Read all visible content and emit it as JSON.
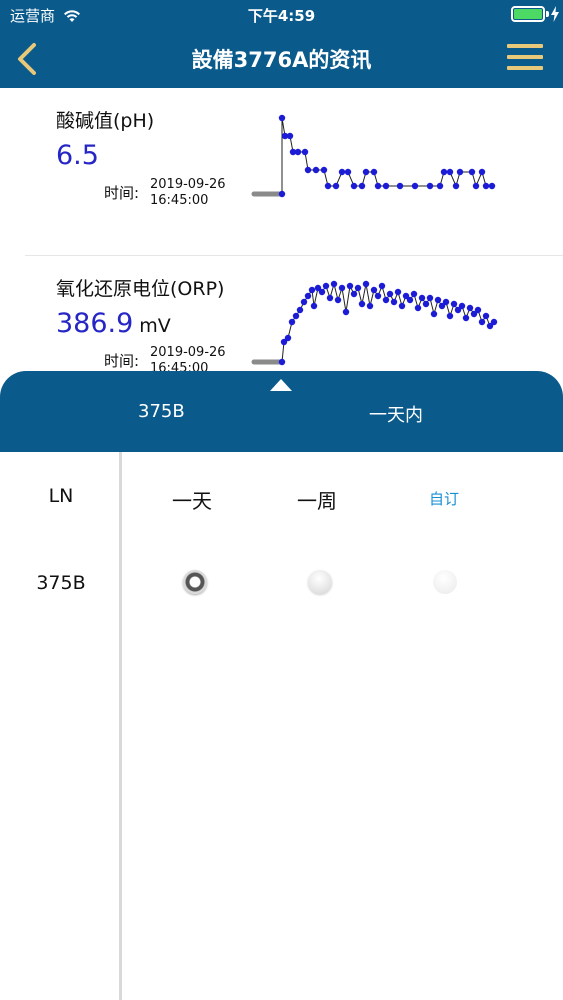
{
  "status_bar": {
    "carrier": "运营商",
    "time": "下午4:59"
  },
  "nav": {
    "title": "設備3776A的资讯",
    "back_icon": "chevron-left-icon",
    "menu_icon": "hamburger-menu-icon",
    "accent_color": "#e8c979",
    "bar_color": "#0a5a8c"
  },
  "sensors": [
    {
      "label": "酸碱值(pH)",
      "value": "6.5",
      "unit": "",
      "time_label": "时间:",
      "time_date": "2019-09-26",
      "time_clock": "16:45:00"
    },
    {
      "label": "氧化还原电位(ORP)",
      "value": "386.9",
      "unit": "mV",
      "time_label": "时间:",
      "time_date": "2019-09-26",
      "time_clock": "16:45:00"
    }
  ],
  "drawer": {
    "device": "375B",
    "range": "一天内",
    "sidebar_header": "LN",
    "sidebar_items": [
      "375B"
    ],
    "columns": [
      "一天",
      "一周",
      "自订"
    ],
    "selected_option": "一天"
  }
}
